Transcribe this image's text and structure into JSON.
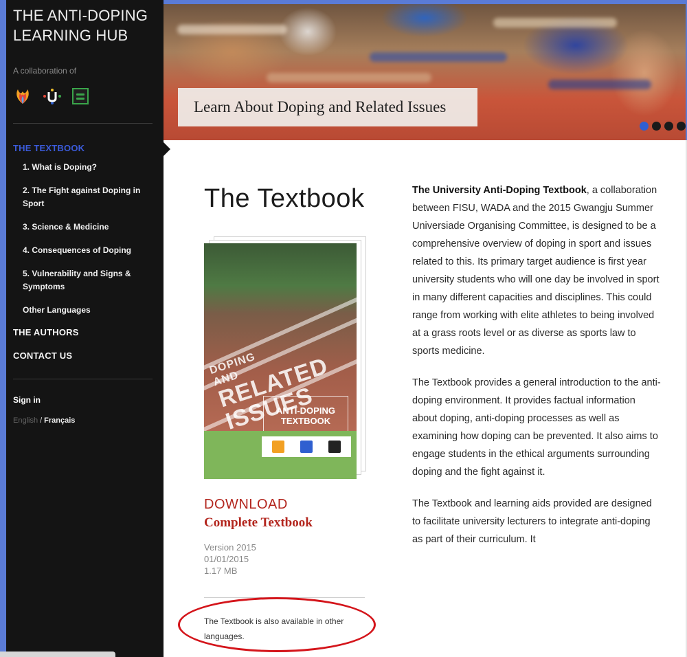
{
  "sidebar": {
    "brand_title_line1": "THE ANTI-DOPING",
    "brand_title_line2": "LEARNING HUB",
    "collab_label": "A collaboration of",
    "section_textbook": "THE TEXTBOOK",
    "nav_items": [
      "1. What is Doping?",
      "2. The Fight against Doping in Sport",
      "3. Science & Medicine",
      "4. Consequences of Doping",
      "5. Vulnerability and Signs & Symptoms",
      "Other Languages"
    ],
    "authors": "THE AUTHORS",
    "contact": "CONTACT US",
    "sign_in": "Sign in",
    "lang_english": "English",
    "lang_separator": "/",
    "lang_french": "Français"
  },
  "hero": {
    "caption": "Learn About Doping and Related Issues"
  },
  "main": {
    "title": "The Textbook",
    "cover_big_text_line1": "DOPING",
    "cover_big_text_line2": "AND",
    "cover_big_text_line3": "RELATED",
    "cover_big_text_line4": "ISSUES",
    "cover_box_line1": "ANTI-DOPING",
    "cover_box_line2": "TEXTBOOK",
    "download_label": "DOWNLOAD",
    "download_sub": "Complete Textbook",
    "version": "Version 2015",
    "date": "01/01/2015",
    "size": "1.17 MB",
    "note": "The Textbook is also available in other languages.",
    "para1_strong": "The University Anti-Doping Textbook",
    "para1_rest": ", a collaboration between FISU, WADA and the 2015 Gwangju Summer Universiade Organising Committee, is designed to be a comprehensive overview of doping in sport and issues related to this. Its primary target audience is first year university students who will one day be involved in sport in many different capacities and disciplines. This could range from working with elite athletes to being involved at a grass roots level or as diverse as sports law to sports medicine.",
    "para2": "The Textbook provides a general introduction to the anti-doping environment. It provides factual information about doping, anti-doping processes as well as examining how doping can be prevented. It also aims to engage students in the ethical arguments surrounding doping and the fight against it.",
    "para3": "The Textbook and learning aids provided are designed to facilitate university lecturers to integrate anti-doping as part of their curriculum. It"
  },
  "colors": {
    "sidebar_bg": "#141414",
    "accent_blue": "#3b5bdb",
    "download_red": "#b3261e",
    "annotation_red": "#d4151b",
    "page_bg": "#5a7bd6"
  },
  "icons": [
    "flame-logo-icon",
    "fisu-logo-icon",
    "wada-logo-icon",
    "carousel-dot-icon"
  ]
}
